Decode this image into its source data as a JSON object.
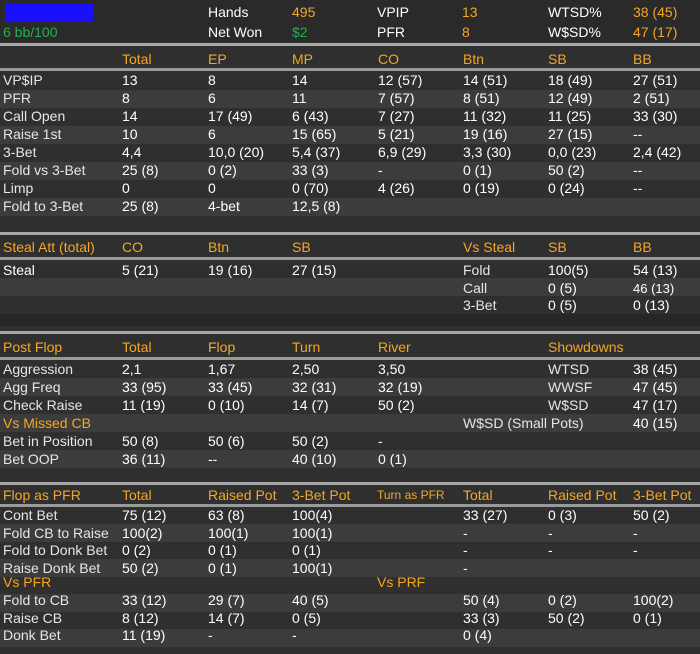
{
  "header": {
    "stakes": "6 bb/100",
    "hands_label": "Hands",
    "hands_value": "495",
    "netwon_label": "Net Won",
    "netwon_value": "$2",
    "vpip_label": "VPIP",
    "vpip_value": "13",
    "pfr_label": "PFR",
    "pfr_value": "8",
    "wtsd_label": "WTSD%",
    "wtsd_value": "38 (45)",
    "wsd_label": "W$SD%",
    "wsd_value": "47 (17)"
  },
  "positional": {
    "headers": [
      "Total",
      "EP",
      "MP",
      "CO",
      "Btn",
      "SB",
      "BB"
    ],
    "rows": [
      {
        "label": "VP$IP",
        "cells": [
          "13",
          "8",
          "14",
          "12 (57)",
          "14 (51)",
          "18 (49)",
          "27 (51)"
        ]
      },
      {
        "label": "PFR",
        "cells": [
          "8",
          "6",
          "11",
          "7 (57)",
          "8 (51)",
          "12 (49)",
          "2 (51)"
        ]
      },
      {
        "label": "Call Open",
        "cells": [
          "14",
          "17 (49)",
          "6 (43)",
          "7 (27)",
          "11 (32)",
          "11 (25)",
          "33 (30)"
        ]
      },
      {
        "label": "Raise 1st",
        "cells": [
          "10",
          "6",
          "15 (65)",
          "5 (21)",
          "19 (16)",
          "27 (15)",
          "--"
        ]
      },
      {
        "label": "3-Bet",
        "cells": [
          "4,4",
          "10,0 (20)",
          "5,4 (37)",
          "6,9 (29)",
          "3,3 (30)",
          "0,0 (23)",
          "2,4 (42)"
        ]
      },
      {
        "label": "Fold vs 3-Bet",
        "cells": [
          "25 (8)",
          "0 (2)",
          "33 (3)",
          "-",
          "0 (1)",
          "50 (2)",
          "--"
        ]
      },
      {
        "label": "Limp",
        "cells": [
          "0",
          "0",
          "0 (70)",
          "4 (26)",
          "0 (19)",
          "0 (24)",
          "--"
        ]
      },
      {
        "label": "Fold to 3-Bet",
        "cells": [
          "25 (8)",
          "4-bet",
          "12,5 (8)",
          "",
          "",
          "",
          ""
        ]
      }
    ]
  },
  "steal": {
    "title": "Steal Att (total)",
    "headers": [
      "CO",
      "Btn",
      "SB"
    ],
    "row_label": "Steal",
    "cells": [
      "5 (21)",
      "19 (16)",
      "27 (15)"
    ],
    "vs_title": "Vs Steal",
    "vs_headers": [
      "SB",
      "BB"
    ],
    "vs_rows": [
      {
        "label": "Fold",
        "cells": [
          "100(5)",
          "54 (13)"
        ]
      },
      {
        "label": "Call",
        "cells": [
          "0 (5)",
          "46 (13)"
        ]
      },
      {
        "label": "3-Bet",
        "cells": [
          "0 (5)",
          "0 (13)"
        ]
      }
    ]
  },
  "postflop": {
    "title": "Post Flop",
    "headers": [
      "Total",
      "Flop",
      "Turn",
      "River"
    ],
    "rows": [
      {
        "label": "Aggression",
        "cells": [
          "2,1",
          "1,67",
          "2,50",
          "3,50"
        ]
      },
      {
        "label": "Agg Freq",
        "cells": [
          "33 (95)",
          "33 (45)",
          "32 (31)",
          "32 (19)"
        ]
      },
      {
        "label": "Check Raise",
        "cells": [
          "11 (19)",
          "0 (10)",
          "14 (7)",
          "50 (2)"
        ]
      }
    ],
    "missed_title": "Vs Missed CB",
    "missed_rows": [
      {
        "label": "Bet in Position",
        "cells": [
          "50 (8)",
          "50 (6)",
          "50 (2)",
          "-"
        ]
      },
      {
        "label": "Bet OOP",
        "cells": [
          "36 (11)",
          "--",
          "40 (10)",
          "0 (1)"
        ]
      }
    ],
    "showdowns_title": "Showdowns",
    "showdowns": [
      {
        "label": "WTSD",
        "value": "38 (45)"
      },
      {
        "label": "WWSF",
        "value": "47 (45)"
      },
      {
        "label": "W$SD",
        "value": "47 (17)"
      },
      {
        "label": "W$SD (Small Pots)",
        "value": "40 (15)"
      }
    ]
  },
  "flop_pfr": {
    "title": "Flop as PFR",
    "headers": [
      "Total",
      "Raised Pot",
      "3-Bet Pot"
    ],
    "rows": [
      {
        "label": "Cont Bet",
        "cells": [
          "75 (12)",
          "63 (8)",
          "100(4)"
        ]
      },
      {
        "label": "Fold CB to Raise",
        "cells": [
          "100(2)",
          "100(1)",
          "100(1)"
        ]
      },
      {
        "label": "Fold to Donk Bet",
        "cells": [
          "0 (2)",
          "0 (1)",
          "0 (1)"
        ]
      },
      {
        "label": "Raise Donk Bet",
        "cells": [
          "50 (2)",
          "0 (1)",
          "100(1)"
        ]
      }
    ],
    "vs_title": "Vs PFR",
    "vs_rows": [
      {
        "label": "Fold to CB",
        "cells": [
          "33 (12)",
          "29 (7)",
          "40 (5)"
        ]
      },
      {
        "label": "Raise CB",
        "cells": [
          "8 (12)",
          "14 (7)",
          "0 (5)"
        ]
      },
      {
        "label": "Donk Bet",
        "cells": [
          "11 (19)",
          "-",
          "-"
        ]
      }
    ]
  },
  "turn_pfr": {
    "title": "Turn as PFR",
    "headers": [
      "Total",
      "Raised Pot",
      "3-Bet Pot"
    ],
    "rows": [
      {
        "cells": [
          "33 (27)",
          "0 (3)",
          "50 (2)"
        ]
      },
      {
        "cells": [
          "-",
          "-",
          "-"
        ]
      },
      {
        "cells": [
          "-",
          "-",
          "-"
        ]
      },
      {
        "cells": [
          "-",
          "",
          ""
        ]
      }
    ],
    "vs_title": "Vs PRF",
    "vs_rows": [
      {
        "cells": [
          "50 (4)",
          "0 (2)",
          "100(2)"
        ]
      },
      {
        "cells": [
          "33 (3)",
          "50 (2)",
          "0 (1)"
        ]
      },
      {
        "cells": [
          "0 (4)",
          "",
          ""
        ]
      }
    ]
  }
}
